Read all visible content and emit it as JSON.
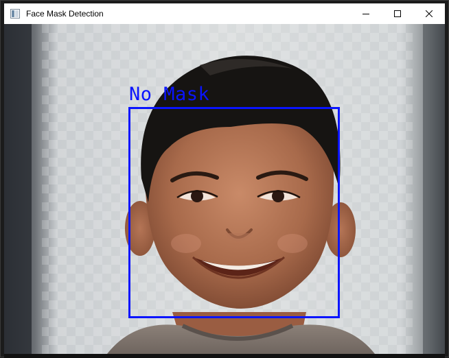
{
  "window": {
    "title": "Face Mask Detection",
    "icon": "opencv-window-icon"
  },
  "title_controls": {
    "minimize": "minimize-icon",
    "maximize": "maximize-icon",
    "close": "close-icon"
  },
  "detection": {
    "label": "No Mask",
    "box_color": "#0a14ff"
  }
}
